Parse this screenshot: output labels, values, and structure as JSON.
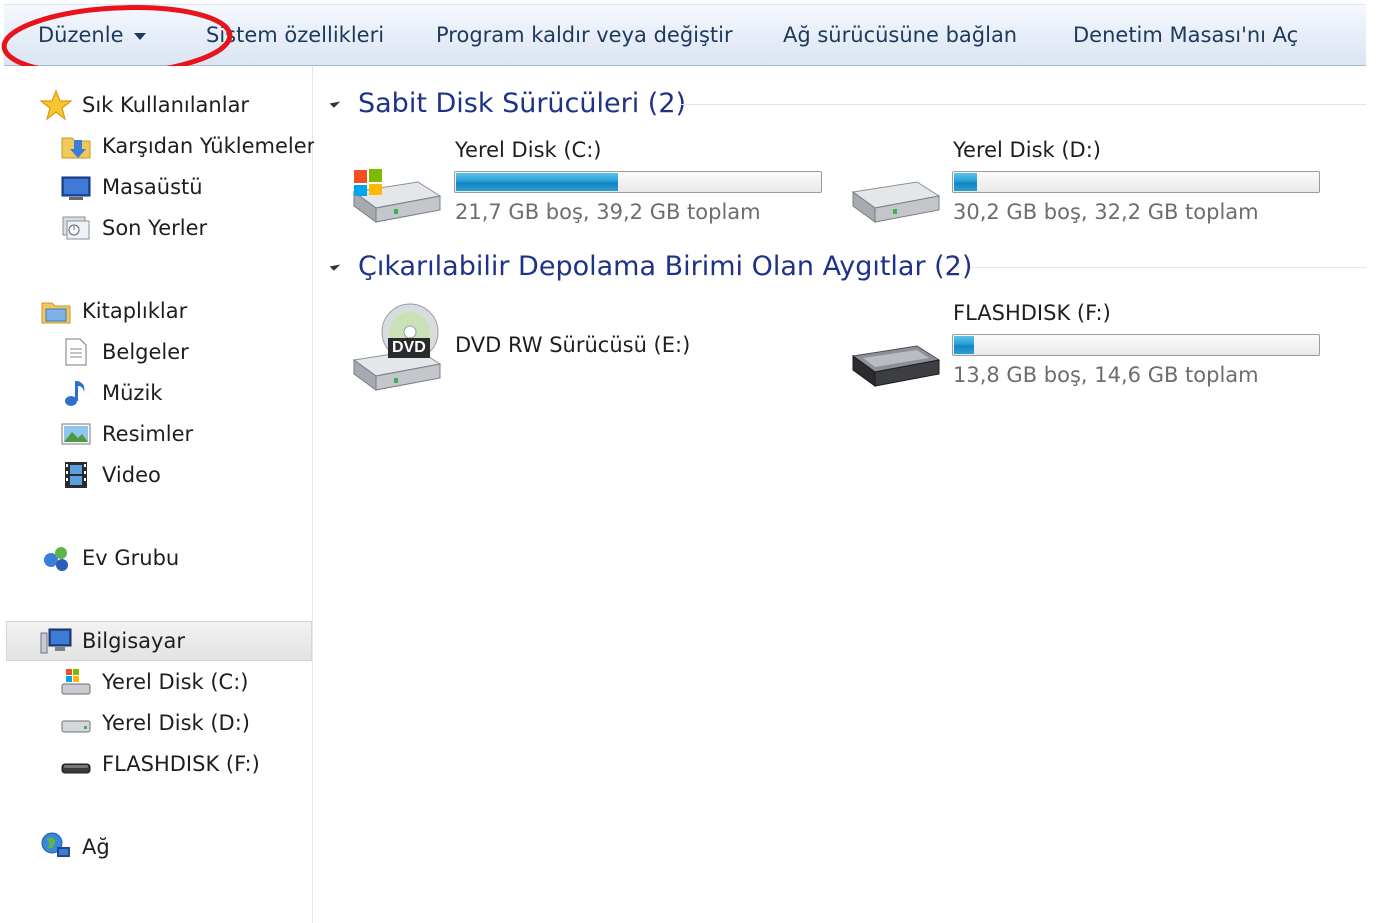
{
  "toolbar": {
    "organize": "Düzenle",
    "system_properties": "Sistem özellikleri",
    "uninstall": "Program kaldır veya değiştir",
    "map_drive": "Ağ sürücüsüne bağlan",
    "control_panel": "Denetim Masası'nı Aç",
    "annotation_color": "#e8141b"
  },
  "nav": {
    "favorites": {
      "label": "Sık Kullanılanlar",
      "items": [
        {
          "label": "Karşıdan Yüklemeler",
          "icon": "downloads-folder-icon"
        },
        {
          "label": "Masaüstü",
          "icon": "desktop-icon"
        },
        {
          "label": "Son Yerler",
          "icon": "recent-places-icon"
        }
      ]
    },
    "libraries": {
      "label": "Kitaplıklar",
      "items": [
        {
          "label": "Belgeler",
          "icon": "documents-icon"
        },
        {
          "label": "Müzik",
          "icon": "music-note-icon"
        },
        {
          "label": "Resimler",
          "icon": "pictures-icon"
        },
        {
          "label": "Video",
          "icon": "film-icon"
        }
      ]
    },
    "homegroup": {
      "label": "Ev Grubu"
    },
    "computer": {
      "label": "Bilgisayar",
      "items": [
        {
          "label": "Yerel Disk (C:)",
          "icon": "system-drive-icon"
        },
        {
          "label": "Yerel Disk (D:)",
          "icon": "hard-drive-icon"
        },
        {
          "label": "FLASHDISK (F:)",
          "icon": "usb-drive-icon"
        }
      ]
    },
    "network": {
      "label": "Ağ"
    }
  },
  "content": {
    "hard_disks": {
      "header": "Sabit Disk Sürücüleri (2)",
      "drives": [
        {
          "name": "Yerel Disk (C:)",
          "free": "21,7 GB boş, 39,2 GB toplam",
          "used_fraction": 0.446
        },
        {
          "name": "Yerel Disk (D:)",
          "free": "30,2 GB boş, 32,2 GB toplam",
          "used_fraction": 0.062
        }
      ]
    },
    "removable": {
      "header": "Çıkarılabilir Depolama Birimi Olan Aygıtlar (2)",
      "dvd": {
        "name": "DVD RW Sürücüsü (E:)",
        "badge": "DVD"
      },
      "flash": {
        "name": "FLASHDISK (F:)",
        "free": "13,8 GB boş, 14,6 GB toplam",
        "used_fraction": 0.055
      }
    }
  }
}
